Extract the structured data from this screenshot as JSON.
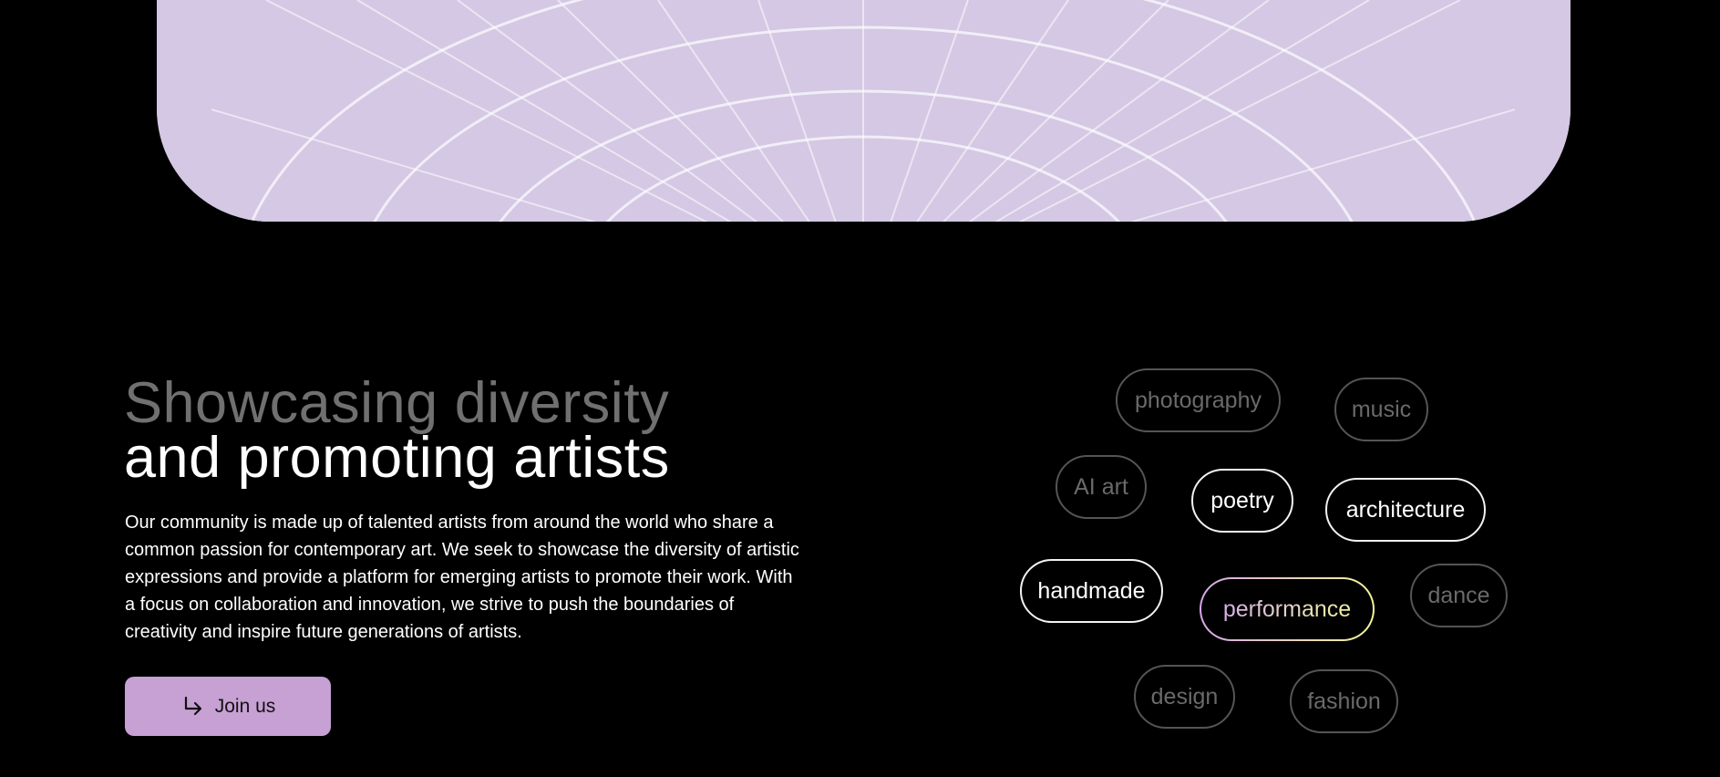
{
  "hero": {
    "image_name": "abstract-3d-spiral-artwork",
    "palette": [
      "#d4c8e4",
      "#9b2fd6",
      "#2aa9c9",
      "#c9c4d3"
    ]
  },
  "heading": {
    "line1": "Showcasing diversity",
    "line2": "and promoting artists"
  },
  "description": "Our community is made up of talented artists from around the world who share a common passion for contemporary art. We seek to showcase the diversity of artistic expressions and provide a platform for emerging artists to promote their work. With a focus on collaboration and innovation, we strive to push the boundaries of creativity and inspire future generations of artists.",
  "cta": {
    "label": "Join us",
    "icon": "arrow-down-right-icon",
    "bg": "#c7a0d4"
  },
  "tags": [
    {
      "label": "photography",
      "style": "dim"
    },
    {
      "label": "music",
      "style": "dim"
    },
    {
      "label": "AI art",
      "style": "dim"
    },
    {
      "label": "poetry",
      "style": "bright"
    },
    {
      "label": "architecture",
      "style": "bright"
    },
    {
      "label": "handmade",
      "style": "bright"
    },
    {
      "label": "performance",
      "style": "gradient"
    },
    {
      "label": "dance",
      "style": "dim"
    },
    {
      "label": "design",
      "style": "dim"
    },
    {
      "label": "fashion",
      "style": "dim"
    }
  ]
}
